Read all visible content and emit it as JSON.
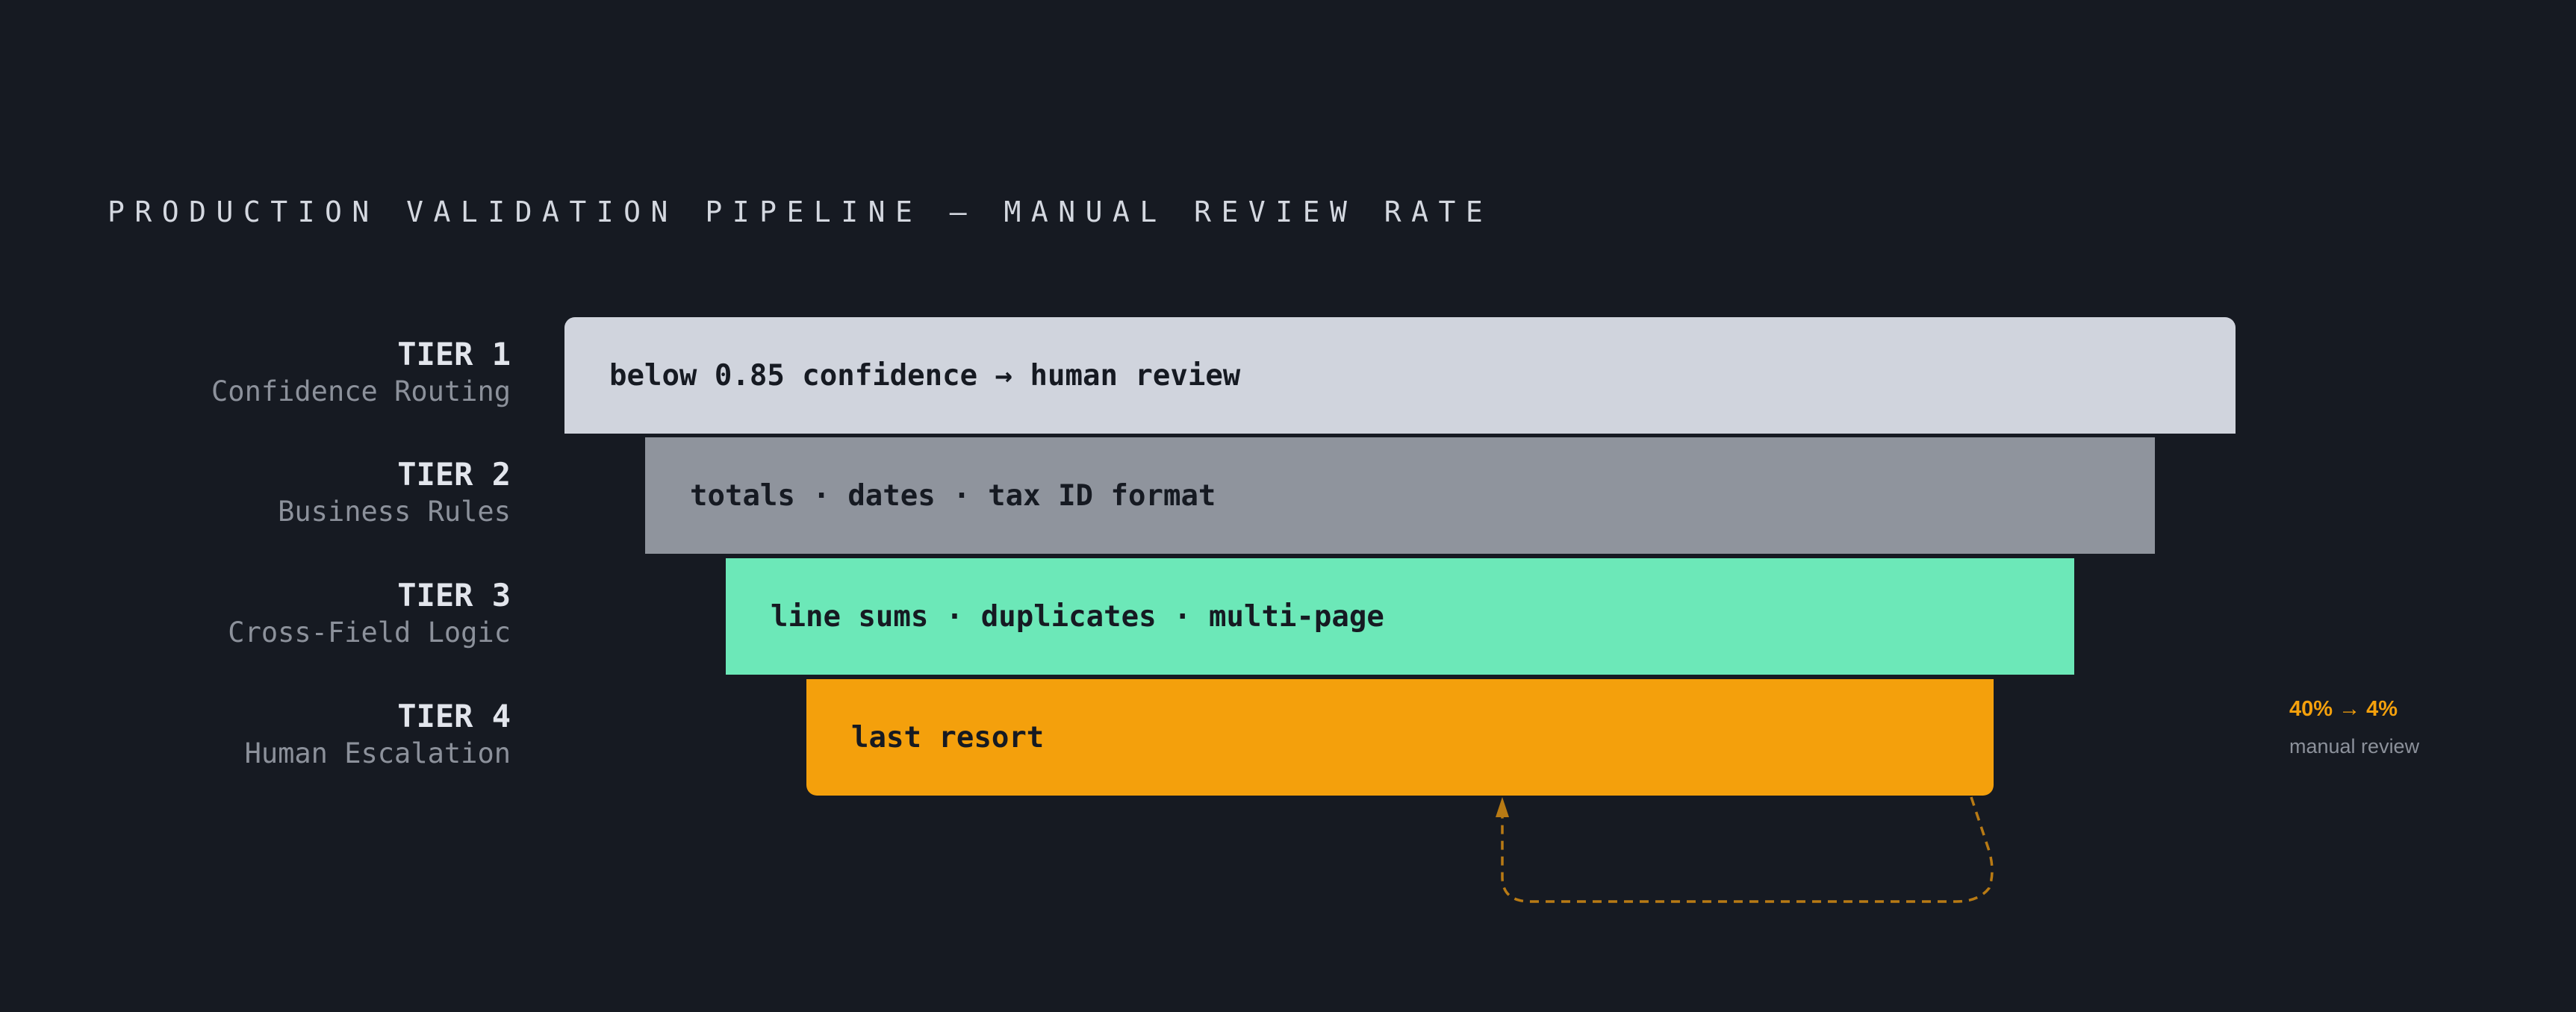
{
  "title": "PRODUCTION VALIDATION PIPELINE — MANUAL REVIEW RATE",
  "tiers": [
    {
      "name": "TIER 1",
      "subtitle": "Confidence Routing",
      "content": "below 0.85 confidence → human review",
      "color": "#d0d4dd"
    },
    {
      "name": "TIER 2",
      "subtitle": "Business Rules",
      "content": "totals · dates · tax ID format",
      "color": "#8f949d"
    },
    {
      "name": "TIER 3",
      "subtitle": "Cross-Field Logic",
      "content": "line sums · duplicates · multi-page",
      "color": "#6ce8b8"
    },
    {
      "name": "TIER 4",
      "subtitle": "Human Escalation",
      "content": "last resort",
      "color": "#f4a00c"
    }
  ],
  "annotation": {
    "value": "40% → 4%",
    "caption": "manual review",
    "accent_color": "#f4a00c"
  },
  "background_color": "#161a22"
}
